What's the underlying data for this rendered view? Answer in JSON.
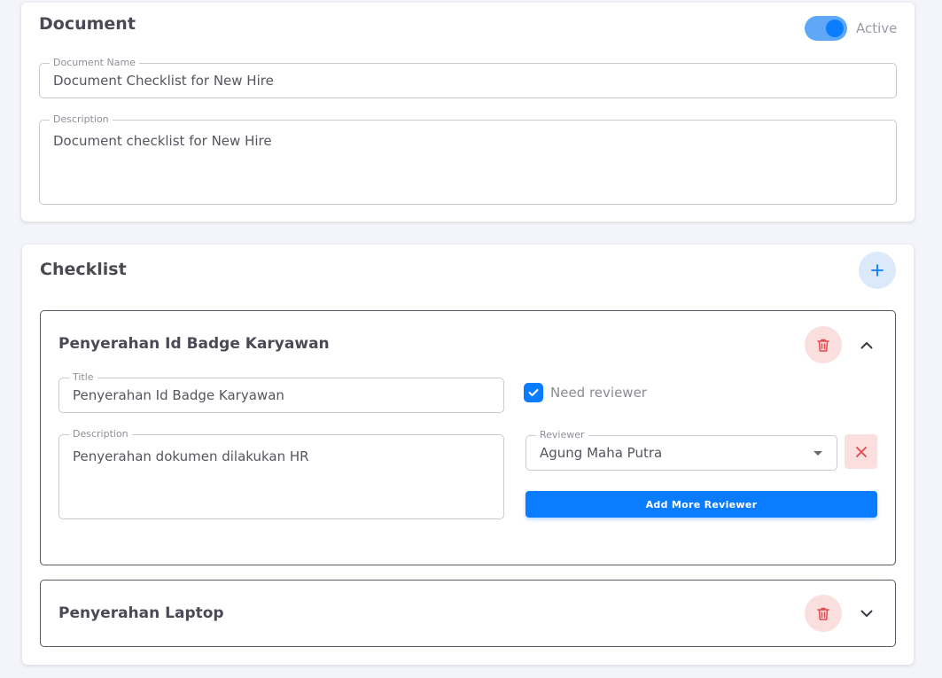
{
  "document": {
    "title": "Document",
    "active_label": "Active",
    "active": true,
    "name_label": "Document Name",
    "name_value": "Document Checklist for New Hire",
    "description_label": "Description",
    "description_value": "Document checklist for New Hire"
  },
  "checklist": {
    "title": "Checklist",
    "items": [
      {
        "heading": "Penyerahan Id Badge Karyawan",
        "expanded": true,
        "title_label": "Title",
        "title_value": "Penyerahan Id Badge Karyawan",
        "description_label": "Description",
        "description_value": "Penyerahan dokumen dilakukan HR",
        "need_reviewer_label": "Need reviewer",
        "need_reviewer": true,
        "reviewer_label": "Reviewer",
        "reviewer_value": "Agung Maha Putra",
        "add_reviewer_label": "Add More Reviewer"
      },
      {
        "heading": "Penyerahan Laptop",
        "expanded": false
      }
    ]
  },
  "colors": {
    "accent": "#0a7cff",
    "danger_bg": "#fbdede",
    "danger": "#e5484d",
    "page_bg": "#f4f5fa"
  },
  "icons": {
    "add": "plus-icon",
    "delete": "trash-icon",
    "collapse": "chevron-up-icon",
    "expand": "chevron-down-icon",
    "remove": "close-icon",
    "dropdown": "caret-down-icon",
    "check": "check-icon"
  }
}
